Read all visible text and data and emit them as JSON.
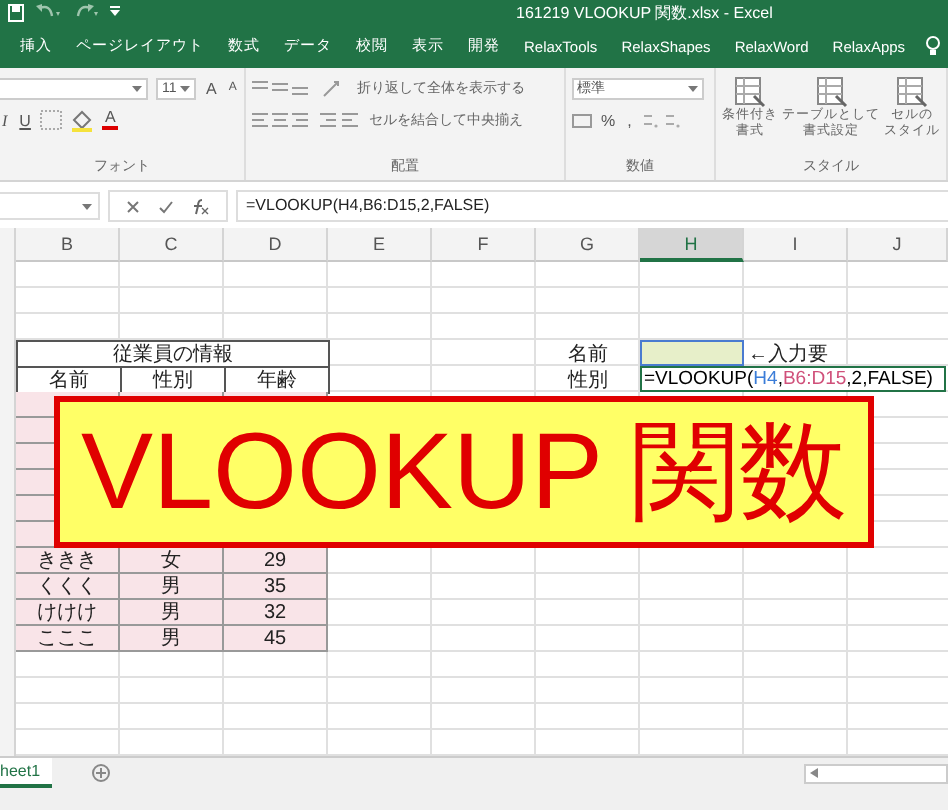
{
  "title_bar": {
    "title": "161219 VLOOKUP 関数.xlsx  -  Excel"
  },
  "ribbon_tabs": [
    "挿入",
    "ページレイアウト",
    "数式",
    "データ",
    "校閲",
    "表示",
    "開発",
    "RelaxTools",
    "RelaxShapes",
    "RelaxWord",
    "RelaxApps"
  ],
  "ribbon": {
    "font": {
      "size": "11",
      "grow": "A",
      "shrink": "A",
      "italic": "I",
      "underline": "U",
      "font_color_button": "A",
      "label": "フォント"
    },
    "alignment": {
      "wrap": "折り返して全体を表示する",
      "merge": "セルを結合して中央揃え",
      "label": "配置"
    },
    "number": {
      "format": "標準",
      "percent": "%",
      "comma": ",",
      "label": "数値"
    },
    "styles": {
      "buttons": [
        {
          "line1": "条件付き",
          "line2": "書式"
        },
        {
          "line1": "テーブルとして",
          "line2": "書式設定"
        },
        {
          "line1": "セルの",
          "line2": "スタイル"
        }
      ],
      "label": "スタイル"
    }
  },
  "formula_bar": {
    "formula": "=VLOOKUP(H4,B6:D15,2,FALSE)"
  },
  "columns": [
    {
      "label": "B",
      "selected": false
    },
    {
      "label": "C",
      "selected": false
    },
    {
      "label": "D",
      "selected": false
    },
    {
      "label": "E",
      "selected": false
    },
    {
      "label": "F",
      "selected": false
    },
    {
      "label": "G",
      "selected": false
    },
    {
      "label": "H",
      "selected": true
    },
    {
      "label": "I",
      "selected": false
    },
    {
      "label": "J",
      "selected": false
    }
  ],
  "table": {
    "title": "従業員の情報",
    "headers": [
      "名前",
      "性別",
      "年齢"
    ],
    "rows": [
      {
        "name": "ききき",
        "gender": "女",
        "age": "29"
      },
      {
        "name": "くくく",
        "gender": "男",
        "age": "35"
      },
      {
        "name": "けけけ",
        "gender": "男",
        "age": "32"
      },
      {
        "name": "こここ",
        "gender": "男",
        "age": "45"
      }
    ]
  },
  "lookup": {
    "labels": [
      "名前",
      "性別"
    ],
    "input_cell": {
      "selected": true
    },
    "hint": "←入力要",
    "formula": [
      {
        "text": "=VLOOKUP("
      },
      {
        "text": "H4",
        "color": "#3b7dd8"
      },
      {
        "text": ","
      },
      {
        "text": "B6:D15",
        "color": "#d0507a"
      },
      {
        "text": ",2,FALSE)"
      }
    ]
  },
  "overlay": {
    "text": "VLOOKUP 関数"
  },
  "sheet_tabs": [
    {
      "label": "heet1",
      "selected": true
    }
  ]
}
